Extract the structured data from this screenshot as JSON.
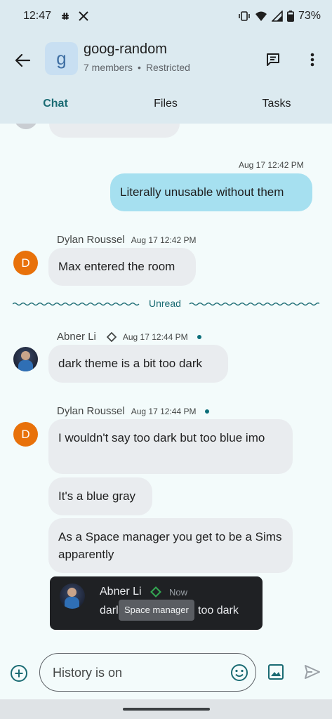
{
  "status_bar": {
    "time": "12:47",
    "battery": "73%",
    "icons": [
      "slack-icon",
      "x-icon",
      "vibrate-icon",
      "wifi-icon",
      "signal-icon",
      "battery-icon"
    ]
  },
  "header": {
    "avatar_letter": "g",
    "title": "goog-random",
    "members": "7 members",
    "separator": "•",
    "access": "Restricted"
  },
  "tabs": [
    {
      "label": "Chat",
      "active": true
    },
    {
      "label": "Files",
      "active": false
    },
    {
      "label": "Tasks",
      "active": false
    }
  ],
  "messages": {
    "m1": {
      "timestamp": "Aug 17 12:42 PM",
      "text": "Literally unusable without them"
    },
    "m2": {
      "sender": "Dylan Roussel",
      "timestamp": "Aug 17 12:42 PM",
      "avatar_letter": "D",
      "text": "Max entered the room"
    },
    "unread_label": "Unread",
    "m3": {
      "sender": "Abner Li",
      "timestamp": "Aug 17 12:44 PM",
      "text": "dark theme is a bit too dark"
    },
    "m4": {
      "sender": "Dylan Roussel",
      "timestamp": "Aug 17 12:44 PM",
      "avatar_letter": "D",
      "texts": [
        "I wouldn't say too dark but too blue imo",
        "It's a blue gray",
        "As a Space manager you get to be a Sims apparently"
      ]
    }
  },
  "toast": {
    "sender": "Abner Li",
    "time": "Now",
    "text_start": "darl",
    "text_end": "too dark",
    "tooltip": "Space manager"
  },
  "composer": {
    "placeholder": "History is on"
  },
  "colors": {
    "accent": "#1a6b73",
    "header_bg": "#dceaf0",
    "my_bubble": "#a6e0f0",
    "other_bubble": "#e9ecef",
    "avatar_orange": "#e8710a",
    "manager_badge": "#34a853"
  }
}
